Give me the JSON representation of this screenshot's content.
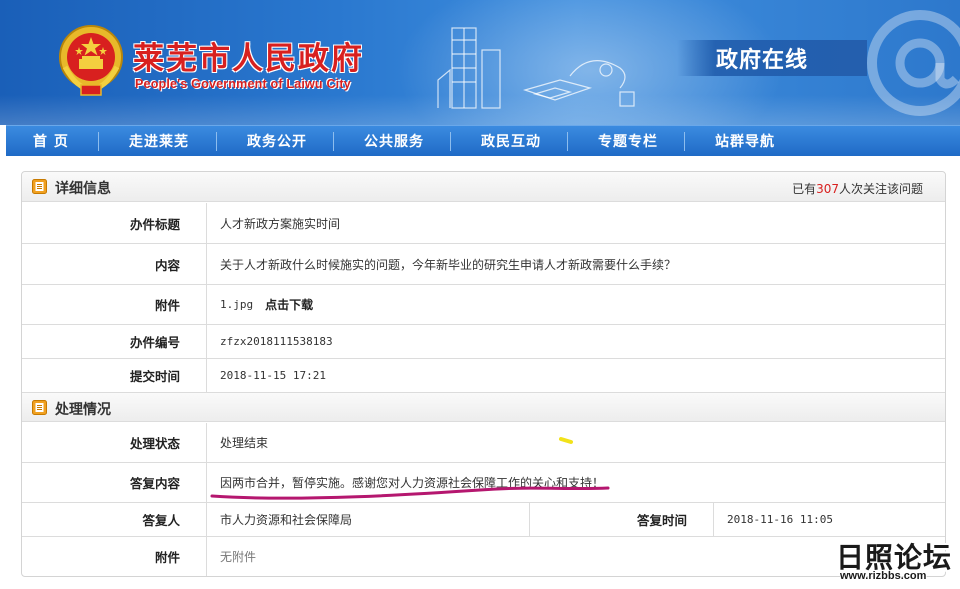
{
  "header": {
    "site_title": "莱芜市人民政府",
    "site_subtitle": "People's Government of Laiwu City",
    "online_label": "政府在线"
  },
  "nav": {
    "items": [
      "首 页",
      "走进莱芜",
      "政务公开",
      "公共服务",
      "政民互动",
      "专题专栏",
      "站群导航"
    ]
  },
  "detail": {
    "section_title": "详细信息",
    "attention_prefix": "已有",
    "attention_count": "307",
    "attention_suffix": "人次关注该问题",
    "rows": {
      "title_label": "办件标题",
      "title_value": "人才新政方案施实时间",
      "content_label": "内容",
      "content_value": "关于人才新政什么时候施实的问题，今年新毕业的研究生申请人才新政需要什么手续？",
      "attach_label": "附件",
      "attach_file": "1.jpg",
      "attach_link": "点击下载",
      "number_label": "办件编号",
      "number_value": "zfzx2018111538183",
      "submit_label": "提交时间",
      "submit_value": "2018-11-15 17:21"
    }
  },
  "processing": {
    "section_title": "处理情况",
    "rows": {
      "status_label": "处理状态",
      "status_value": "处理结束",
      "reply_label": "答复内容",
      "reply_value": "因两市合并，暂停实施。感谢您对人力资源社会保障工作的关心和支持！",
      "replier_label": "答复人",
      "replier_value": "市人力资源和社会保障局",
      "reply_time_label": "答复时间",
      "reply_time_value": "2018-11-16 11:05",
      "attach_label": "附件",
      "attach_value": "无附件"
    }
  },
  "watermark": {
    "text": "日照论坛",
    "url": "www.rizbbs.com"
  },
  "colors": {
    "banner_blue": "#2a78cf",
    "title_red": "#d8201f",
    "underline_magenta": "#b5176f",
    "highlight_yellow": "#f2e21a"
  }
}
